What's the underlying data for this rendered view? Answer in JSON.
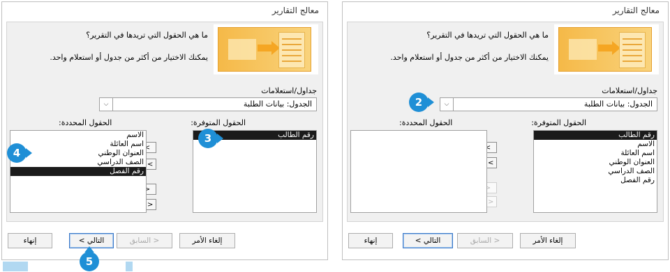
{
  "left_dialog": {
    "title": "معالج التقارير",
    "question": "ما هي الحقول التي تريدها في التقرير؟",
    "hint": "يمكنك الاختيار من أكثر من جدول أو استعلام واحد.",
    "tables_label": "جداول/استعلامات",
    "combo_value": "الجدول: بيانات الطلبة",
    "available_label": "الحقول المتوفرة:",
    "selected_label": "الحقول المحددة:",
    "available_fields": [
      "رقم الطالب"
    ],
    "selected_fields": [
      "الاسم",
      "اسم العائلة",
      "العنوان الوطني",
      "الصف الدراسي",
      "رقم الفصل"
    ],
    "buttons": {
      "move_one": ">",
      "move_all": ">>",
      "back_one": "<",
      "back_all": "<<"
    },
    "footer": {
      "cancel": "إلغاء الأمر",
      "previous": "< السابق",
      "next": "التالي >",
      "finish": "إنهاء"
    }
  },
  "right_dialog": {
    "title": "معالج التقارير",
    "question": "ما هي الحقول التي تريدها في التقرير؟",
    "hint": "يمكنك الاختيار من أكثر من جدول أو استعلام واحد.",
    "tables_label": "جداول/استعلامات",
    "combo_value": "الجدول: بيانات الطلبة",
    "available_label": "الحقول المتوفرة:",
    "selected_label": "الحقول المحددة:",
    "available_fields": [
      "رقم الطالب",
      "الاسم",
      "اسم العائلة",
      "العنوان الوطني",
      "الصف الدراسي",
      "رقم الفصل"
    ],
    "selected_fields": [],
    "buttons": {
      "move_one": ">",
      "move_all": ">>",
      "back_one": "<",
      "back_all": "<<"
    },
    "footer": {
      "cancel": "إلغاء الأمر",
      "previous": "< السابق",
      "next": "التالي >",
      "finish": "إنهاء"
    }
  },
  "badges": {
    "b2": "2",
    "b3": "3",
    "b4": "4",
    "b5": "5"
  },
  "colors": {
    "badge": "#1f8fd6",
    "selection": "#1b1b1b",
    "graphic": "#f5b948"
  }
}
